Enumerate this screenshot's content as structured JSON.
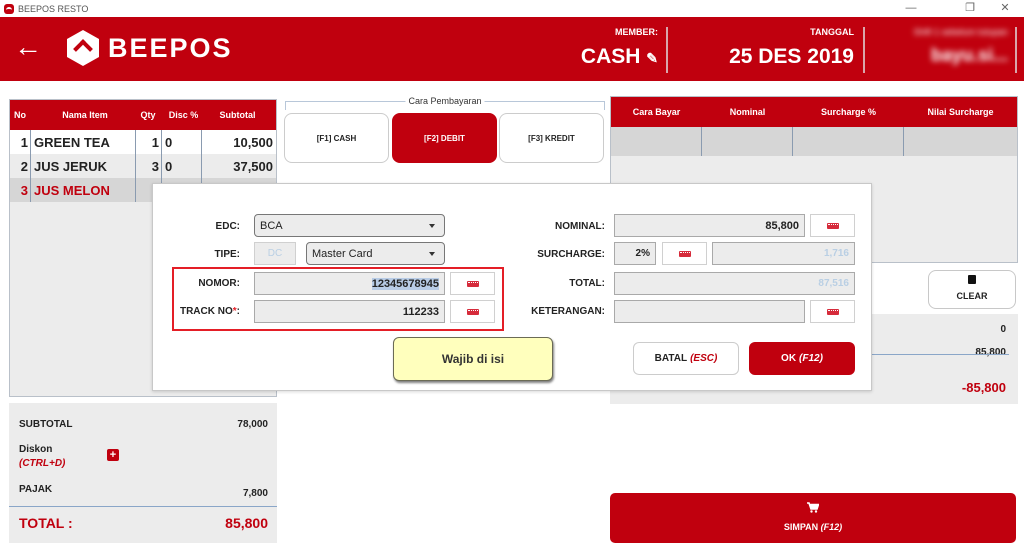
{
  "window": {
    "title": "BEEPOS RESTO",
    "controls": {
      "minimize": "—",
      "restore": "❐",
      "close": "✕"
    }
  },
  "header": {
    "back_icon": "←",
    "logo_text": "BEEPOS",
    "member_label": "MEMBER:",
    "member_value": "CASH",
    "edit_icon": "✎",
    "date_label": "TANGGAL",
    "date_value": "25 DES 2019",
    "user_label": "Shift 1 sebelum tutupan",
    "user_value": "bayu.si..."
  },
  "order_table": {
    "columns": [
      "No",
      "Nama Item",
      "Qty",
      "Disc %",
      "Subtotal"
    ],
    "rows": [
      {
        "no": "1",
        "name": "GREEN TEA",
        "qty": "1",
        "disc": "0",
        "subtotal": "10,500"
      },
      {
        "no": "2",
        "name": "JUS JERUK",
        "qty": "3",
        "disc": "0",
        "subtotal": "37,500"
      },
      {
        "no": "3",
        "name": "JUS MELON",
        "qty": "",
        "disc": "",
        "subtotal": ""
      }
    ]
  },
  "summary": {
    "subtotal_label": "SUBTOTAL",
    "subtotal_value": "78,000",
    "diskon_label": "Diskon",
    "diskon_shortcut": "(CTRL+D)",
    "add_icon": "+",
    "pajak_label": "PAJAK",
    "pajak_value": "7,800",
    "total_label": "TOTAL :",
    "total_value": "85,800"
  },
  "payment_methods": {
    "title": "Cara Pembayaran",
    "options": [
      {
        "label": "[F1] CASH",
        "active": false
      },
      {
        "label": "[F2] DEBIT",
        "active": true
      },
      {
        "label": "[F3] KREDIT",
        "active": false
      }
    ]
  },
  "payment_table": {
    "columns": [
      "Cara Bayar",
      "Nominal",
      "Surcharge %",
      "Nilai Surcharge"
    ]
  },
  "right_panel": {
    "clear_label": "CLEAR",
    "trash_icon": "🗑",
    "value1": "0",
    "value2": "85,800",
    "balance": "-85,800",
    "simpan_label": "SIMPAN",
    "simpan_shortcut": "(F12)",
    "cart_icon": "🛒"
  },
  "modal": {
    "edc_label": "EDC:",
    "edc_value": "BCA",
    "tipe_label": "TIPE:",
    "tipe_code": "DC",
    "tipe_value": "Master Card",
    "nomor_label": "NOMOR:",
    "nomor_value": "12345678945",
    "track_label": "TRACK NO",
    "track_required": "*",
    "track_colon": ":",
    "track_value": "112233",
    "nominal_label": "NOMINAL:",
    "nominal_value": "85,800",
    "surcharge_label": "SURCHARGE:",
    "surcharge_pct": "2%",
    "surcharge_value": "1,716",
    "total_label": "TOTAL:",
    "total_value": "87,516",
    "keterangan_label": "KETERANGAN:",
    "keterangan_value": "",
    "tooltip": "Wajib di isi",
    "cancel_label": "BATAL",
    "cancel_shortcut": "(ESC)",
    "ok_label": "OK",
    "ok_shortcut": "(F12)"
  },
  "colors": {
    "brand": "#c0000e",
    "muted_value": "#b9cfe4",
    "tooltip_bg": "#ffffbd",
    "highlight": "#e41e26"
  }
}
